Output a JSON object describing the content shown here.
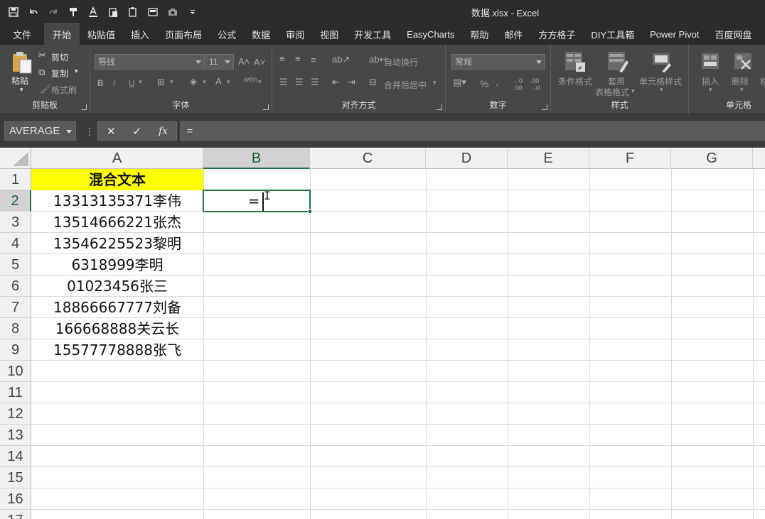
{
  "titlebar": {
    "title": "数据.xlsx  -  Excel",
    "qat_icons": [
      "save-icon",
      "undo-icon",
      "redo-icon",
      "format-painter-icon",
      "font-color-icon",
      "paste-special-icon",
      "paste-values-icon",
      "print-preview-icon",
      "camera-icon",
      "customize-qat-icon"
    ]
  },
  "tabs": [
    "文件",
    "开始",
    "粘贴值",
    "插入",
    "页面布局",
    "公式",
    "数据",
    "审阅",
    "视图",
    "开发工具",
    "EasyCharts",
    "帮助",
    "邮件",
    "方方格子",
    "DIY工具箱",
    "Power Pivot",
    "百度网盘"
  ],
  "active_tab": "开始",
  "ribbon": {
    "clipboard": {
      "label": "剪贴板",
      "paste": "粘贴",
      "cut": "剪切",
      "copy": "复制",
      "painter": "格式刷"
    },
    "font": {
      "label": "字体",
      "font_name": "等线",
      "font_size": "11",
      "bold": "B",
      "italic": "I",
      "underline": "U",
      "phonetic": "wén"
    },
    "alignment": {
      "label": "对齐方式",
      "wrap": "自动换行",
      "merge": "合并后居中"
    },
    "number": {
      "label": "数字",
      "format": "常规",
      "percent": "%",
      "comma": ","
    },
    "styles": {
      "label": "样式",
      "conditional": "条件格式",
      "table_format_1": "套用",
      "table_format_2": "表格格式",
      "cell_styles": "单元格样式"
    },
    "cells": {
      "label": "单元格",
      "insert": "插入",
      "delete": "删除",
      "format": "格"
    }
  },
  "formula_bar": {
    "name_box": "AVERAGE",
    "formula": "="
  },
  "grid": {
    "columns": [
      "A",
      "B",
      "C",
      "D",
      "E",
      "F",
      "G"
    ],
    "rows": [
      "1",
      "2",
      "3",
      "4",
      "5",
      "6",
      "7",
      "8",
      "9",
      "10",
      "11",
      "12",
      "13",
      "14",
      "15",
      "16",
      "17"
    ],
    "selected_column": "B",
    "selected_row": "2",
    "header_cell": "混合文本",
    "values": [
      "13313135371李伟",
      "13514666221张杰",
      "13546225523黎明",
      "6318999李明",
      "01023456张三",
      "18866667777刘备",
      "166668888关云长",
      "15577778888张飞"
    ],
    "active_cell_value": "="
  }
}
